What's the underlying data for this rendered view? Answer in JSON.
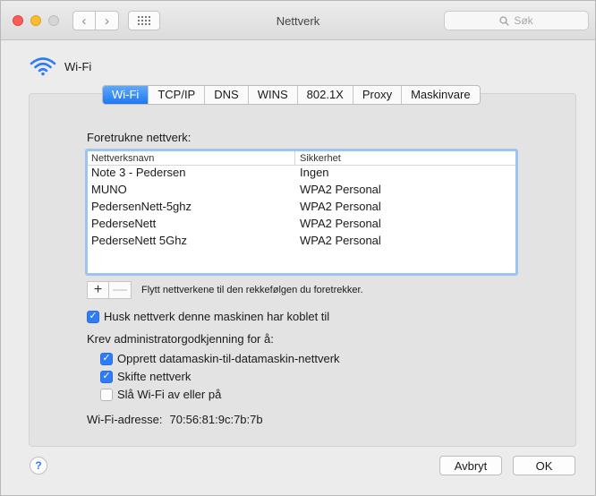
{
  "window": {
    "title": "Nettverk"
  },
  "toolbar": {
    "search_placeholder": "Søk",
    "back_glyph": "‹",
    "forward_glyph": "›"
  },
  "header": {
    "label": "Wi-Fi",
    "icon": "wifi-icon"
  },
  "tabs": [
    {
      "label": "Wi-Fi",
      "active": true
    },
    {
      "label": "TCP/IP",
      "active": false
    },
    {
      "label": "DNS",
      "active": false
    },
    {
      "label": "WINS",
      "active": false
    },
    {
      "label": "802.1X",
      "active": false
    },
    {
      "label": "Proxy",
      "active": false
    },
    {
      "label": "Maskinvare",
      "active": false
    }
  ],
  "preferred": {
    "label": "Foretrukne nettverk:",
    "columns": {
      "name": "Nettverksnavn",
      "security": "Sikkerhet"
    },
    "rows": [
      {
        "name": "Note 3 - Pedersen",
        "security": "Ingen"
      },
      {
        "name": "MUNO",
        "security": "WPA2 Personal"
      },
      {
        "name": "PedersenNett-5ghz",
        "security": "WPA2 Personal"
      },
      {
        "name": "PederseNett",
        "security": "WPA2 Personal"
      },
      {
        "name": "PederseNett 5Ghz",
        "security": "WPA2 Personal"
      }
    ],
    "add_glyph": "+",
    "remove_glyph": "—",
    "hint": "Flytt nettverkene til den rekkefølgen du foretrekker."
  },
  "options": {
    "remember": {
      "label": "Husk nettverk denne maskinen har koblet til",
      "checked": true
    },
    "require_label": "Krev administratorgodkjenning for å:",
    "create_adhoc": {
      "label": "Opprett datamaskin-til-datamaskin-nettverk",
      "checked": true
    },
    "change_network": {
      "label": "Skifte nettverk",
      "checked": true
    },
    "toggle_wifi": {
      "label": "Slå Wi-Fi av eller på",
      "checked": false
    }
  },
  "address": {
    "label": "Wi-Fi-adresse:",
    "value": "70:56:81:9c:7b:7b"
  },
  "footer": {
    "help": "?",
    "cancel": "Avbryt",
    "ok": "OK"
  },
  "colors": {
    "accent": "#2f7cf6",
    "close": "#fc5d57",
    "minimize": "#fdbc2e"
  }
}
